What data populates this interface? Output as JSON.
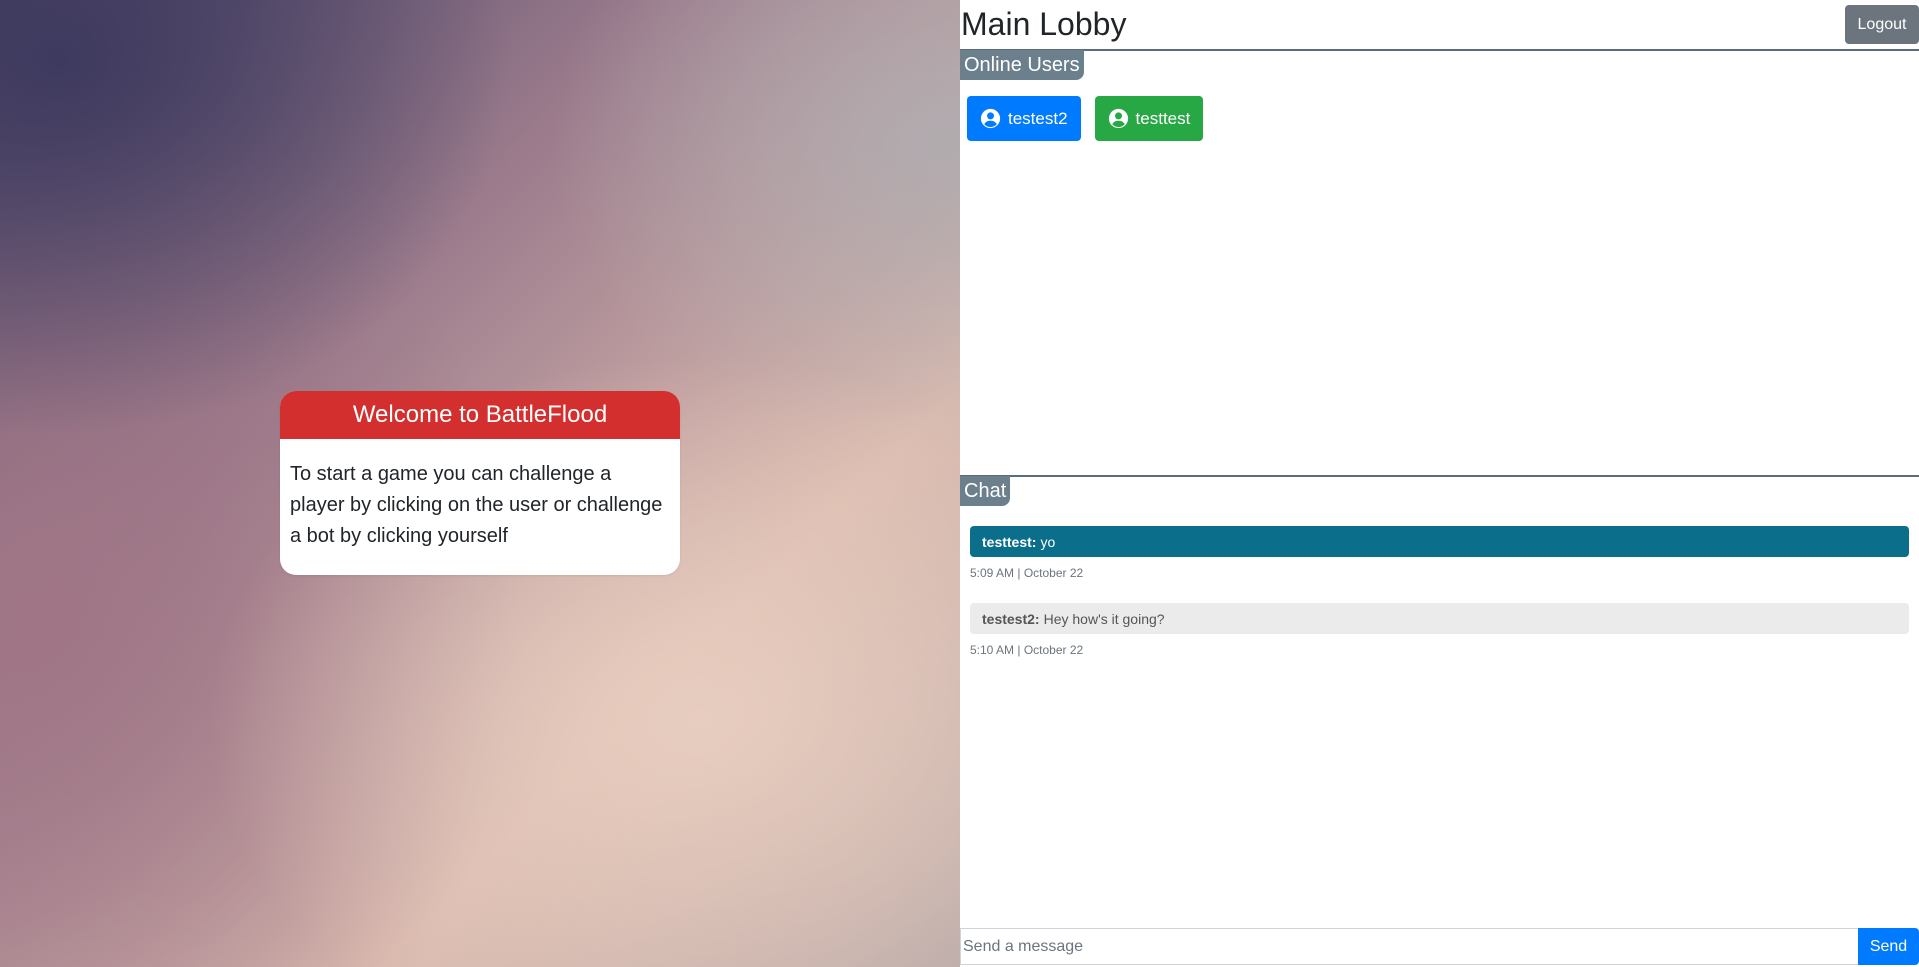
{
  "welcome": {
    "title": "Welcome to BattleFlood",
    "body": "To start a game you can challenge a player by clicking on the user or challenge a bot by clicking yourself"
  },
  "lobby": {
    "title": "Main Lobby",
    "logout_label": "Logout"
  },
  "online_users": {
    "label": "Online Users",
    "users": [
      {
        "name": "testest2",
        "icon": "user-circle-icon",
        "color": "#007bff"
      },
      {
        "name": "testtest",
        "icon": "user-circle-icon",
        "color": "#28a745"
      }
    ]
  },
  "chat": {
    "label": "Chat",
    "messages": [
      {
        "sender": "testtest:",
        "text": "yo",
        "time": "5:09 AM | October 22",
        "own": true
      },
      {
        "sender": "testest2:",
        "text": "Hey how's it going?",
        "time": "5:10 AM | October 22",
        "own": false
      }
    ],
    "input_placeholder": "Send a message",
    "input_value": "",
    "send_label": "Send"
  },
  "colors": {
    "welcome_header": "#d32f2f",
    "section_tab": "#6c7f8d",
    "own_message": "#0b6f8c",
    "other_message": "#ebebeb",
    "primary": "#007bff",
    "success": "#28a745",
    "secondary": "#6c757d"
  }
}
